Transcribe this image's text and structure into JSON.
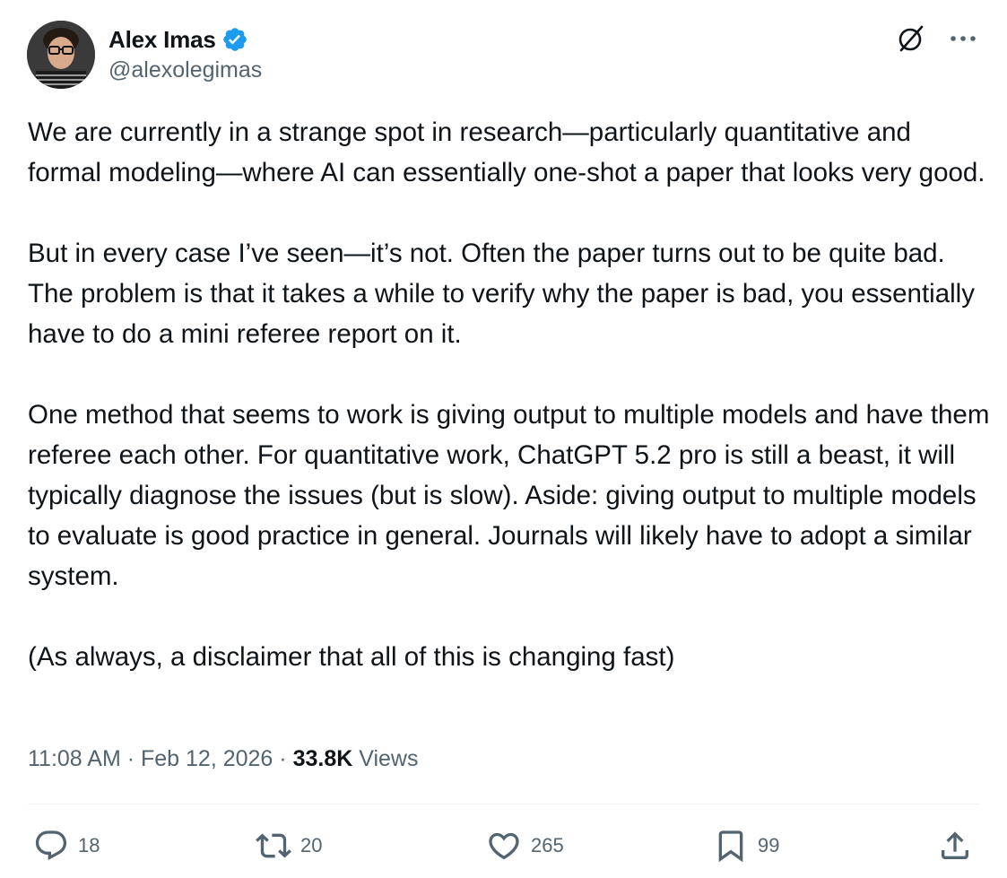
{
  "author": {
    "display_name": "Alex Imas",
    "handle": "@alexolegimas",
    "verified": true,
    "verified_color": "#1d9bf0"
  },
  "icons": {
    "top_right": [
      "grok-icon",
      "more-icon"
    ],
    "avatar": "avatar-photo"
  },
  "post": {
    "paragraphs": [
      "We are currently in a strange spot in research—particularly quantitative and formal modeling—where AI can essentially one-shot a paper that looks very good.",
      "But in every case I’ve seen—it’s not. Often the paper turns out to be quite bad. The problem is that it takes a while to verify why the paper is bad, you essentially have to do a mini referee report on it.",
      "One method that seems to work is giving output to multiple models and have them referee each other. For quantitative work, ChatGPT 5.2 pro is still a beast, it will typically diagnose the issues (but is slow). Aside: giving output to multiple models to evaluate is good practice in general. Journals will likely have to adopt a similar system.",
      "(As always, a disclaimer that all of this is changing fast)"
    ]
  },
  "meta": {
    "time": "11:08 AM",
    "separator": " · ",
    "date": "Feb 12, 2026",
    "views_count": "33.8K",
    "views_label": " Views"
  },
  "actions": {
    "replies": "18",
    "reposts": "20",
    "likes": "265",
    "bookmarks": "99"
  },
  "colors": {
    "text_primary": "#0f1419",
    "text_secondary": "#536471",
    "divider": "#eff3f4"
  }
}
